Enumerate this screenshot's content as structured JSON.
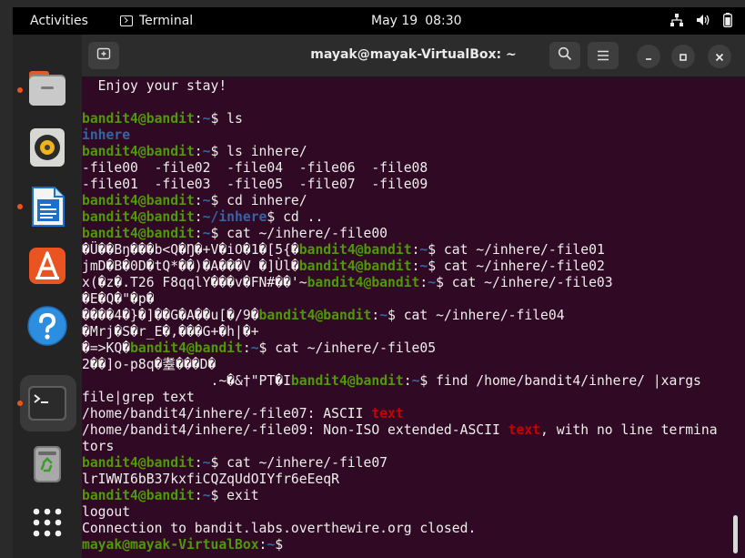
{
  "topbar": {
    "activities": "Activities",
    "app_name": "Terminal",
    "date": "May 19",
    "time": "08:30"
  },
  "dock": {
    "items": [
      "files-icon",
      "rhythmbox-icon",
      "libreoffice-writer-icon",
      "app-center-icon",
      "help-icon",
      "terminal-icon",
      "trash-icon",
      "show-apps-icon"
    ]
  },
  "window": {
    "title": "mayak@mayak-VirtualBox: ~"
  },
  "terminal": {
    "lines": [
      [
        {
          "t": "  Enjoy your stay!",
          "c": ""
        }
      ],
      [
        {
          "t": "",
          "c": ""
        }
      ],
      [
        {
          "t": "bandit4@bandit",
          "c": "pu"
        },
        {
          "t": ":",
          "c": ""
        },
        {
          "t": "~",
          "c": "pp"
        },
        {
          "t": "$ ls",
          "c": ""
        }
      ],
      [
        {
          "t": "inhere",
          "c": "dir"
        }
      ],
      [
        {
          "t": "bandit4@bandit",
          "c": "pu"
        },
        {
          "t": ":",
          "c": ""
        },
        {
          "t": "~",
          "c": "pp"
        },
        {
          "t": "$ ls inhere/",
          "c": ""
        }
      ],
      [
        {
          "t": "-file00  -file02  -file04  -file06  -file08",
          "c": ""
        }
      ],
      [
        {
          "t": "-file01  -file03  -file05  -file07  -file09",
          "c": ""
        }
      ],
      [
        {
          "t": "bandit4@bandit",
          "c": "pu"
        },
        {
          "t": ":",
          "c": ""
        },
        {
          "t": "~",
          "c": "pp"
        },
        {
          "t": "$ cd inhere/",
          "c": ""
        }
      ],
      [
        {
          "t": "bandit4@bandit",
          "c": "pu"
        },
        {
          "t": ":",
          "c": ""
        },
        {
          "t": "~/inhere",
          "c": "pp"
        },
        {
          "t": "$ cd ..",
          "c": ""
        }
      ],
      [
        {
          "t": "bandit4@bandit",
          "c": "pu"
        },
        {
          "t": ":",
          "c": ""
        },
        {
          "t": "~",
          "c": "pp"
        },
        {
          "t": "$ cat ~/inhere/-file00",
          "c": ""
        }
      ],
      [
        {
          "t": "�Ü��Bŋ���b<Q�Ŋ�+V�iO�1�[5{�",
          "c": ""
        },
        {
          "t": "bandit4@bandit",
          "c": "pu"
        },
        {
          "t": ":",
          "c": ""
        },
        {
          "t": "~",
          "c": "pp"
        },
        {
          "t": "$ cat ~/inhere/-file01",
          "c": ""
        }
      ],
      [
        {
          "t": "jmD�B�0D�tQ*��)�A���V �]Ùl�",
          "c": ""
        },
        {
          "t": "bandit4@bandit",
          "c": "pu"
        },
        {
          "t": ":",
          "c": ""
        },
        {
          "t": "~",
          "c": "pp"
        },
        {
          "t": "$ cat ~/inhere/-file02",
          "c": ""
        }
      ],
      [
        {
          "t": "x(�z�.T26 F8qqlY���v�FN#��'~",
          "c": ""
        },
        {
          "t": "bandit4@bandit",
          "c": "pu"
        },
        {
          "t": ":",
          "c": ""
        },
        {
          "t": "~",
          "c": "pp"
        },
        {
          "t": "$ cat ~/inhere/-file03",
          "c": ""
        }
      ],
      [
        {
          "t": "�E�Q�\"�p�",
          "c": ""
        }
      ],
      [
        {
          "t": "����4�}�]��G�A��u[�/9�",
          "c": ""
        },
        {
          "t": "bandit4@bandit",
          "c": "pu"
        },
        {
          "t": ":",
          "c": ""
        },
        {
          "t": "~",
          "c": "pp"
        },
        {
          "t": "$ cat ~/inhere/-file04",
          "c": ""
        }
      ],
      [
        {
          "t": "�Mrj�S�r_E�,���G+�h|�+",
          "c": ""
        }
      ],
      [
        {
          "t": "�=>KQ�",
          "c": ""
        },
        {
          "t": "bandit4@bandit",
          "c": "pu"
        },
        {
          "t": ":",
          "c": ""
        },
        {
          "t": "~",
          "c": "pp"
        },
        {
          "t": "$ cat ~/inhere/-file05",
          "c": ""
        }
      ],
      [
        {
          "t": "2��]o-p8q�耋���D�",
          "c": ""
        }
      ],
      [
        {
          "t": "                .~�&†\"PT�I",
          "c": ""
        },
        {
          "t": "bandit4@bandit",
          "c": "pu"
        },
        {
          "t": ":",
          "c": ""
        },
        {
          "t": "~",
          "c": "pp"
        },
        {
          "t": "$ find /home/bandit4/inhere/ |xargs",
          "c": ""
        }
      ],
      [
        {
          "t": "file|grep text",
          "c": ""
        }
      ],
      [
        {
          "t": "/home/bandit4/inhere/-file07: ASCII ",
          "c": ""
        },
        {
          "t": "text",
          "c": "hl"
        }
      ],
      [
        {
          "t": "/home/bandit4/inhere/-file09: Non-ISO extended-ASCII ",
          "c": ""
        },
        {
          "t": "text",
          "c": "hl"
        },
        {
          "t": ", with no line termina",
          "c": ""
        }
      ],
      [
        {
          "t": "tors",
          "c": ""
        }
      ],
      [
        {
          "t": "bandit4@bandit",
          "c": "pu"
        },
        {
          "t": ":",
          "c": ""
        },
        {
          "t": "~",
          "c": "pp"
        },
        {
          "t": "$ cat ~/inhere/-file07",
          "c": ""
        }
      ],
      [
        {
          "t": "lrIWWI6bB37kxfiCQZqUdOIYfr6eEeqR",
          "c": ""
        }
      ],
      [
        {
          "t": "bandit4@bandit",
          "c": "pu"
        },
        {
          "t": ":",
          "c": ""
        },
        {
          "t": "~",
          "c": "pp"
        },
        {
          "t": "$ exit",
          "c": ""
        }
      ],
      [
        {
          "t": "logout",
          "c": ""
        }
      ],
      [
        {
          "t": "Connection to bandit.labs.overthewire.org closed.",
          "c": ""
        }
      ],
      [
        {
          "t": "mayak@mayak-VirtualBox",
          "c": "pu"
        },
        {
          "t": ":",
          "c": ""
        },
        {
          "t": "~",
          "c": "pp"
        },
        {
          "t": "$ ",
          "c": ""
        }
      ]
    ]
  },
  "colors": {
    "terminal_bg": "#300a24",
    "prompt_user": "#4e9a06",
    "prompt_path": "#3465a4",
    "highlight": "#cc0000",
    "accent": "#e95420"
  }
}
